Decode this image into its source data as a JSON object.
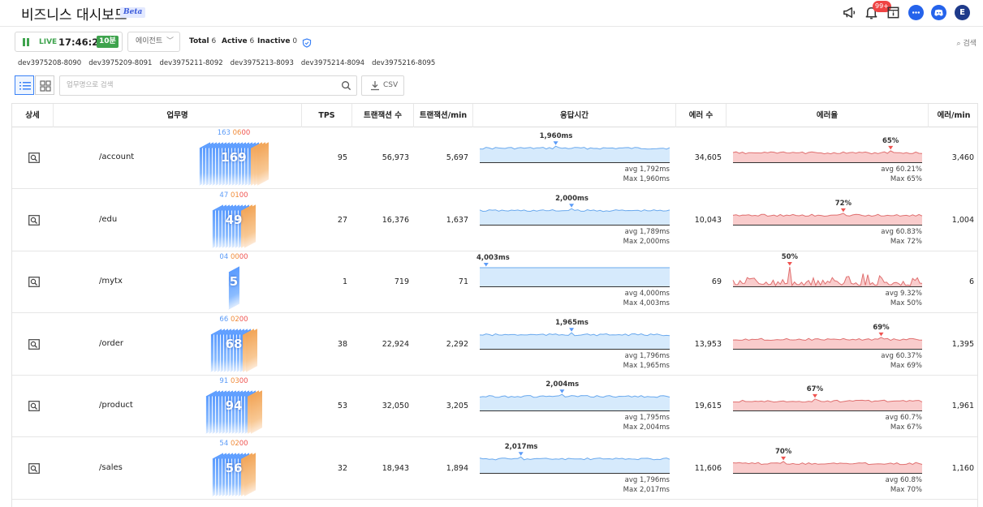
{
  "header": {
    "title": "비즈니스 대시보드",
    "beta": "Beta",
    "bell_badge": "99+",
    "user_initial": "E"
  },
  "toolbar": {
    "live_label": "LIVE",
    "clock": "17:46:24",
    "interval": "10분",
    "agent_select": "에이전트",
    "total_label": "Total",
    "total_value": "6",
    "active_label": "Active",
    "active_value": "6",
    "inactive_label": "Inactive",
    "inactive_value": "0",
    "search_label": "검색"
  },
  "agents": [
    "dev3975208-8090",
    "dev3975209-8091",
    "dev3975211-8092",
    "dev3975213-8093",
    "dev3975214-8094",
    "dev3975216-8095"
  ],
  "table_toolbar": {
    "search_placeholder": "업무명으로 검색",
    "csv_label": "CSV"
  },
  "columns": [
    "상세",
    "업무명",
    "TPS",
    "트랜잭션 수",
    "트랜잭션/min",
    "응답시간",
    "에러 수",
    "에러율",
    "에러/min"
  ],
  "rows": [
    {
      "name": "/account",
      "active": "169",
      "n1": "163",
      "n2": "06",
      "n3": "00",
      "blue_layers": 16,
      "orange_layers": 3,
      "tps": "95",
      "tx": "56,973",
      "txmin": "5,697",
      "resp_peak": "1,960ms",
      "resp_peak_pos": 0.4,
      "resp_avg": "avg 1,792ms",
      "resp_max": "Max 1,960ms",
      "resp_level": 0.82,
      "errors": "34,605",
      "err_peak": "65%",
      "err_peak_pos": 0.84,
      "err_avg": "avg 60.21%",
      "err_max": "Max 65%",
      "err_level": 0.6,
      "errmin": "3,460",
      "err_style": "smooth"
    },
    {
      "name": "/edu",
      "active": "49",
      "n1": "47",
      "n2": "01",
      "n3": "00",
      "blue_layers": 9,
      "orange_layers": 2,
      "tps": "27",
      "tx": "16,376",
      "txmin": "1,637",
      "resp_peak": "2,000ms",
      "resp_peak_pos": 0.49,
      "resp_avg": "avg 1,789ms",
      "resp_max": "Max 2,000ms",
      "resp_level": 0.82,
      "errors": "10,043",
      "err_peak": "72%",
      "err_peak_pos": 0.59,
      "err_avg": "avg 60.83%",
      "err_max": "Max 72%",
      "err_level": 0.6,
      "errmin": "1,004",
      "err_style": "smooth"
    },
    {
      "name": "/mytx",
      "active": "5",
      "n1": "04",
      "n2": "00",
      "n3": "00",
      "blue_layers": 1,
      "orange_layers": 0,
      "tps": "1",
      "tx": "719",
      "txmin": "71",
      "resp_peak": "4,003ms",
      "resp_peak_pos": 0.03,
      "resp_avg": "avg 4,000ms",
      "resp_max": "Max 4,003ms",
      "resp_level": 1.0,
      "errors": "69",
      "err_peak": "50%",
      "err_peak_pos": 0.3,
      "err_avg": "avg 9.32%",
      "err_max": "Max 50%",
      "err_level": 0.1,
      "errmin": "6",
      "err_style": "spiky"
    },
    {
      "name": "/order",
      "active": "68",
      "n1": "66",
      "n2": "02",
      "n3": "00",
      "blue_layers": 10,
      "orange_layers": 2,
      "tps": "38",
      "tx": "22,924",
      "txmin": "2,292",
      "resp_peak": "1,965ms",
      "resp_peak_pos": 0.49,
      "resp_avg": "avg 1,796ms",
      "resp_max": "Max 1,965ms",
      "resp_level": 0.82,
      "errors": "13,953",
      "err_peak": "69%",
      "err_peak_pos": 0.79,
      "err_avg": "avg 60.37%",
      "err_max": "Max 69%",
      "err_level": 0.6,
      "errmin": "1,395",
      "err_style": "smooth"
    },
    {
      "name": "/product",
      "active": "94",
      "n1": "91",
      "n2": "03",
      "n3": "00",
      "blue_layers": 13,
      "orange_layers": 2,
      "tps": "53",
      "tx": "32,050",
      "txmin": "3,205",
      "resp_peak": "2,004ms",
      "resp_peak_pos": 0.44,
      "resp_avg": "avg 1,795ms",
      "resp_max": "Max 2,004ms",
      "resp_level": 0.82,
      "errors": "19,615",
      "err_peak": "67%",
      "err_peak_pos": 0.43,
      "err_avg": "avg 60.7%",
      "err_max": "Max 67%",
      "err_level": 0.6,
      "errmin": "1,961",
      "err_style": "smooth"
    },
    {
      "name": "/sales",
      "active": "56",
      "n1": "54",
      "n2": "02",
      "n3": "00",
      "blue_layers": 9,
      "orange_layers": 2,
      "tps": "32",
      "tx": "18,943",
      "txmin": "1,894",
      "resp_peak": "2,017ms",
      "resp_peak_pos": 0.21,
      "resp_avg": "avg 1,796ms",
      "resp_max": "Max 2,017ms",
      "resp_level": 0.82,
      "errors": "11,606",
      "err_peak": "70%",
      "err_peak_pos": 0.26,
      "err_avg": "avg 60.8%",
      "err_max": "Max 70%",
      "err_level": 0.6,
      "errmin": "1,160",
      "err_style": "smooth"
    }
  ],
  "colors": {
    "live_green": "#3ea34d",
    "resp_fill": "#d6eafc",
    "resp_line": "#6aa9ee",
    "err_fill": "#f9cccc",
    "err_line": "#e07070",
    "accent_blue": "#2563eb"
  }
}
